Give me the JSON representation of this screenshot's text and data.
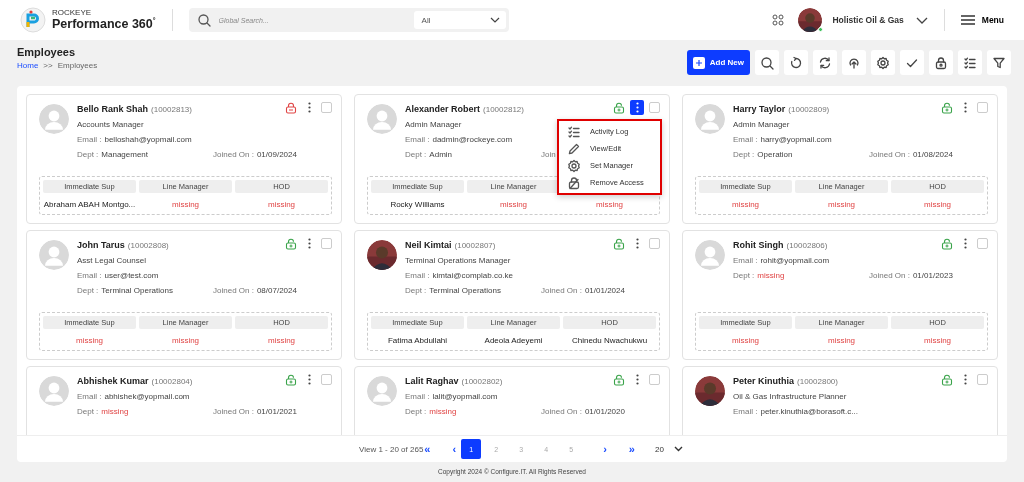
{
  "header": {
    "brand": "ROCKEYE",
    "product": "Performance 360$^{°}$",
    "search": {
      "placeholder": "Global Search..."
    },
    "scope": "All",
    "company": "Holistic Oil & Gas",
    "online": true,
    "menu": "Menu"
  },
  "page": {
    "title": "Employees",
    "breadcrumb": [
      {
        "label": "Home",
        "link": true
      },
      {
        "label": ">>",
        "link": false
      },
      {
        "label": "Employees",
        "link": false
      }
    ]
  },
  "toolbar": {
    "add": "Add New",
    "tools": [
      {
        "kind": "search"
      },
      {
        "kind": "reset"
      },
      {
        "kind": "sync"
      },
      {
        "kind": "upload"
      },
      {
        "kind": "settings"
      },
      {
        "kind": "check"
      },
      {
        "kind": "lock"
      },
      {
        "kind": "checklist"
      },
      {
        "kind": "filter"
      }
    ]
  },
  "employees": [
    {
      "name": "Bello Rank Shah",
      "id": "(10002813)",
      "role": "Accounts Manager",
      "email_label": "Email :",
      "email": "belloshah@yopmail.com",
      "dept_label": "Dept :",
      "dept": "Management",
      "dept_missing": false,
      "joined_label": "Joined On :",
      "joined": "01/09/2024",
      "photo": false,
      "locked": true,
      "menu_open": false,
      "checked": false,
      "managers": [
        {
          "label": "Immediate Sup",
          "value": "Abraham ABAH Montgo...",
          "missing": false
        },
        {
          "label": "Line Manager",
          "value": "missing",
          "missing": true
        },
        {
          "label": "HOD",
          "value": "missing",
          "missing": true
        }
      ]
    },
    {
      "name": "Alexander Robert",
      "id": "(10002812)",
      "role": "Admin Manager",
      "email_label": "Email :",
      "email": "dadmin@rockeye.com",
      "dept_label": "Dept :",
      "dept": "Admin",
      "dept_missing": false,
      "joined_label": "Join",
      "photo": false,
      "locked": false,
      "menu_open": true,
      "checked": false,
      "managers": [
        {
          "label": "Immediate Sup",
          "value": "Rocky Williams",
          "missing": false
        },
        {
          "label": "Line Manager",
          "value": "missing",
          "missing": true
        },
        {
          "value": "missing",
          "missing": true
        }
      ]
    },
    {
      "name": "Harry Taylor",
      "id": "(10002809)",
      "role": "Admin Manager",
      "email_label": "Email :",
      "email": "harry@yopmail.com",
      "dept_label": "Dept :",
      "dept": "Operation",
      "dept_missing": false,
      "joined_label": "Joined On :",
      "joined": "01/08/2024",
      "photo": false,
      "locked": false,
      "menu_open": false,
      "checked": false,
      "managers": [
        {
          "label": "Immediate Sup",
          "value": "missing",
          "missing": true
        },
        {
          "label": "Line Manager",
          "value": "missing",
          "missing": true
        },
        {
          "label": "HOD",
          "value": "missing",
          "missing": true
        }
      ]
    },
    {
      "name": "John Tarus",
      "id": "(10002808)",
      "role": "Asst Legal Counsel",
      "email_label": "Email :",
      "email": "user@test.com",
      "dept_label": "Dept :",
      "dept": "Terminal Operations",
      "dept_missing": false,
      "joined_label": "Joined On :",
      "joined": "08/07/2024",
      "photo": false,
      "locked": false,
      "menu_open": false,
      "checked": false,
      "managers": [
        {
          "label": "Immediate Sup",
          "value": "missing",
          "missing": true
        },
        {
          "label": "Line Manager",
          "value": "missing",
          "missing": true
        },
        {
          "label": "HOD",
          "value": "missing",
          "missing": true
        }
      ]
    },
    {
      "name": "Neil Kimtai",
      "id": "(10002807)",
      "role": "Terminal Operations Manager",
      "email_label": "Email :",
      "email": "kimtai@complab.co.ke",
      "dept_label": "Dept :",
      "dept": "Terminal Operations",
      "dept_missing": false,
      "joined_label": "Joined On :",
      "joined": "01/01/2024",
      "photo": true,
      "locked": false,
      "menu_open": false,
      "checked": false,
      "managers": [
        {
          "label": "Immediate Sup",
          "value": "Fatima Abdullahi",
          "missing": false
        },
        {
          "label": "Line Manager",
          "value": "Adeola Adeyemi",
          "missing": false
        },
        {
          "label": "HOD",
          "value": "Chinedu Nwachukwu",
          "missing": false
        }
      ]
    },
    {
      "name": "Rohit Singh",
      "id": "(10002806)",
      "email_label": "Email :",
      "email": "rohit@yopmail.com",
      "dept_label": "Dept :",
      "dept": "missing",
      "dept_missing": true,
      "joined_label": "Joined On :",
      "joined": "01/01/2023",
      "photo": false,
      "locked": false,
      "menu_open": false,
      "checked": false,
      "managers": [
        {
          "label": "Immediate Sup",
          "value": "missing",
          "missing": true
        },
        {
          "label": "Line Manager",
          "value": "missing",
          "missing": true
        },
        {
          "label": "HOD",
          "value": "missing",
          "missing": true
        }
      ]
    },
    {
      "name": "Abhishek Kumar",
      "id": "(10002804)",
      "email_label": "Email :",
      "email": "abhishek@yopmail.com",
      "dept_label": "Dept :",
      "dept": "missing",
      "dept_missing": true,
      "joined_label": "Joined On :",
      "joined": "01/01/2021",
      "photo": false,
      "locked": false,
      "menu_open": false,
      "checked": false
    },
    {
      "name": "Lalit Raghav",
      "id": "(10002802)",
      "email_label": "Email :",
      "email": "lalit@yopmail.com",
      "dept_label": "Dept :",
      "dept": "missing",
      "dept_missing": true,
      "joined_label": "Joined On :",
      "joined": "01/01/2020",
      "photo": false,
      "locked": false,
      "menu_open": false,
      "checked": false
    },
    {
      "name": "Peter Kinuthia",
      "id": "(10002800)",
      "role": "Oil & Gas Infrastructure Planner",
      "email_label": "Email :",
      "email": "peter.kinuthia@borasoft.c...",
      "photo": true,
      "locked": false,
      "menu_open": false,
      "checked": false
    }
  ],
  "action_menu": [
    {
      "kind": "log",
      "label": "Activity Log"
    },
    {
      "kind": "edit",
      "label": "View/Edit"
    },
    {
      "kind": "manager",
      "label": "Set Manager"
    },
    {
      "kind": "access",
      "label": "Remove Access"
    }
  ],
  "pagination": {
    "summary": "View 1 - 20 of 265",
    "first": "«",
    "prev": "‹",
    "pages": [
      {
        "label": "1",
        "selected": true
      },
      {
        "label": "2",
        "selected": false
      },
      {
        "label": "3",
        "selected": false
      },
      {
        "label": "4",
        "selected": false
      },
      {
        "label": "5",
        "selected": false
      }
    ],
    "next": "›",
    "last": "»",
    "page_size": "20"
  },
  "footer": "Copyright 2024 © Configure.IT. All Rights Reserved"
}
